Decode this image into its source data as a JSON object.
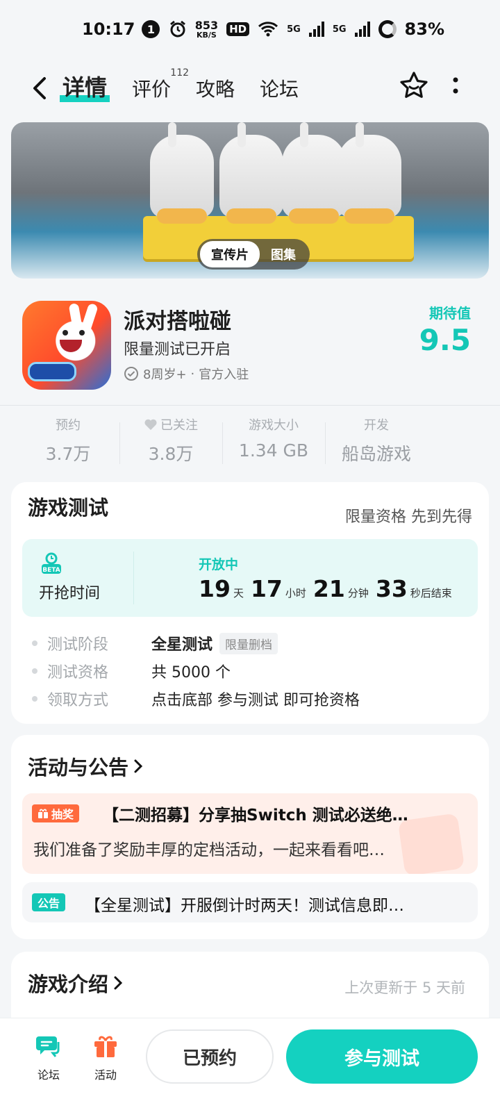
{
  "status_bar": {
    "time": "10:17",
    "notification_count": "1",
    "net_speed_value": "853",
    "net_speed_unit": "KB/S",
    "hd_label": "HD",
    "signal1": "5G",
    "signal2": "5G",
    "battery": "83%"
  },
  "nav": {
    "tabs": [
      {
        "label": "详情",
        "active": true
      },
      {
        "label": "评价",
        "count": "112"
      },
      {
        "label": "攻略"
      },
      {
        "label": "论坛"
      }
    ]
  },
  "banner": {
    "toggle_active": "宣传片",
    "toggle_inactive": "图集"
  },
  "game": {
    "name": "派对搭啦碰",
    "status": "限量测试已开启",
    "age_rating": "8周岁+",
    "meta_sep": "·",
    "official": "官方入驻",
    "expect_label": "期待值",
    "expect_value": "9.5"
  },
  "stats": [
    {
      "label": "预约",
      "value": "3.7万"
    },
    {
      "label": "已关注",
      "value": "3.8万",
      "icon": "heart-icon"
    },
    {
      "label": "游戏大小",
      "value": "1.34 GB"
    },
    {
      "label": "开发",
      "value": "船岛游戏"
    }
  ],
  "test_section": {
    "title": "游戏测试",
    "tag": "限量资格 先到先得",
    "grab_label": "开抢时间",
    "open_label": "开放中",
    "countdown": {
      "days": "19",
      "days_unit": "天",
      "hours": "17",
      "hours_unit": "小时",
      "minutes": "21",
      "minutes_unit": "分钟",
      "seconds": "33",
      "seconds_unit": "秒后结束"
    },
    "info": [
      {
        "key": "测试阶段",
        "value": "全星测试",
        "chip": "限量删档"
      },
      {
        "key": "测试资格",
        "value": "共 5000 个"
      },
      {
        "key": "领取方式",
        "value": "点击底部 参与测试 即可抢资格"
      }
    ]
  },
  "activity_section": {
    "title": "活动与公告",
    "lottery_tag": "抽奖",
    "lottery_title": "【二测招募】分享抽Switch 测试必送绝…",
    "lottery_desc": "我们准备了奖励丰厚的定档活动，一起来看看吧…",
    "notice_tag": "公告",
    "notice_title": "【全星测试】开服倒计时两天！测试信息即…"
  },
  "intro_section": {
    "title": "游戏介绍",
    "updated": "上次更新于 5 天前"
  },
  "bottom_bar": {
    "forum_label": "论坛",
    "activity_label": "活动",
    "reserved_label": "已预约",
    "join_label": "参与测试"
  },
  "colors": {
    "accent": "#14c7b6",
    "lottery": "#ff6a3d"
  }
}
